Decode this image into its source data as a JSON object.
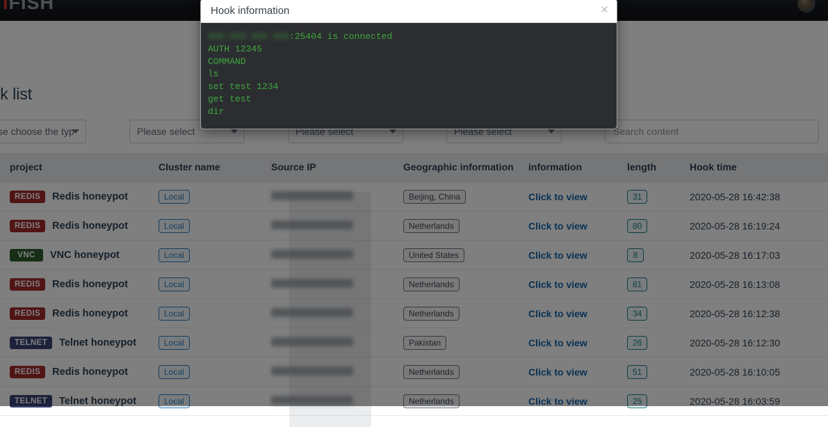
{
  "navbar": {
    "brand_mark": "i",
    "brand_text": "FISH",
    "avatar_label": "user-avatar"
  },
  "page": {
    "title": "Hook list"
  },
  "filters": {
    "type_select": "Please choose the typ",
    "cluster_select": "Please select",
    "third_select": "Please select",
    "fourth_select": "Please select",
    "search_placeholder": "Search content",
    "search_value": ""
  },
  "table": {
    "columns": [
      "",
      "project",
      "Cluster name",
      "Source IP",
      "Geographic information",
      "information",
      "length",
      "Hook time"
    ],
    "rows": [
      {
        "badge": "REDIS",
        "badge_type": "redis",
        "project": "Redis honeypot",
        "cluster": "Local",
        "source_ip": "",
        "geo": "Beijing, China",
        "info_link": "Click to view",
        "length": "31",
        "hook_time": "2020-05-28 16:42:38"
      },
      {
        "badge": "REDIS",
        "badge_type": "redis",
        "project": "Redis honeypot",
        "cluster": "Local",
        "source_ip": "",
        "geo": "Netherlands",
        "info_link": "Click to view",
        "length": "80",
        "hook_time": "2020-05-28 16:19:24"
      },
      {
        "badge": "VNC",
        "badge_type": "vnc",
        "project": "VNC honeypot",
        "cluster": "Local",
        "source_ip": "",
        "geo": "United States",
        "info_link": "Click to view",
        "length": "8",
        "hook_time": "2020-05-28 16:17:03"
      },
      {
        "badge": "REDIS",
        "badge_type": "redis",
        "project": "Redis honeypot",
        "cluster": "Local",
        "source_ip": "",
        "geo": "Netherlands",
        "info_link": "Click to view",
        "length": "81",
        "hook_time": "2020-05-28 16:13:08"
      },
      {
        "badge": "REDIS",
        "badge_type": "redis",
        "project": "Redis honeypot",
        "cluster": "Local",
        "source_ip": "",
        "geo": "Netherlands",
        "info_link": "Click to view",
        "length": "34",
        "hook_time": "2020-05-28 16:12:38"
      },
      {
        "badge": "TELNET",
        "badge_type": "telnet",
        "project": "Telnet honeypot",
        "cluster": "Local",
        "source_ip": "",
        "geo": "Pakistan",
        "info_link": "Click to view",
        "length": "26",
        "hook_time": "2020-05-28 16:12:30"
      },
      {
        "badge": "REDIS",
        "badge_type": "redis",
        "project": "Redis honeypot",
        "cluster": "Local",
        "source_ip": "",
        "geo": "Netherlands",
        "info_link": "Click to view",
        "length": "51",
        "hook_time": "2020-05-28 16:10:05"
      },
      {
        "badge": "TELNET",
        "badge_type": "telnet",
        "project": "Telnet honeypot",
        "cluster": "Local",
        "source_ip": "",
        "geo": "Netherlands",
        "info_link": "Click to view",
        "length": "25",
        "hook_time": "2020-05-28 16:03:59"
      }
    ]
  },
  "modal": {
    "title": "Hook information",
    "close_label": "×",
    "terminal_lines": [
      {
        "redacted": "000.000.000.000",
        "text": ":25404 is connected"
      },
      {
        "redacted": "",
        "text": "AUTH 12345"
      },
      {
        "redacted": "",
        "text": "COMMAND"
      },
      {
        "redacted": "",
        "text": "ls"
      },
      {
        "redacted": "",
        "text": "set test 1234"
      },
      {
        "redacted": "",
        "text": "get test"
      },
      {
        "redacted": "",
        "text": "dir"
      }
    ]
  }
}
